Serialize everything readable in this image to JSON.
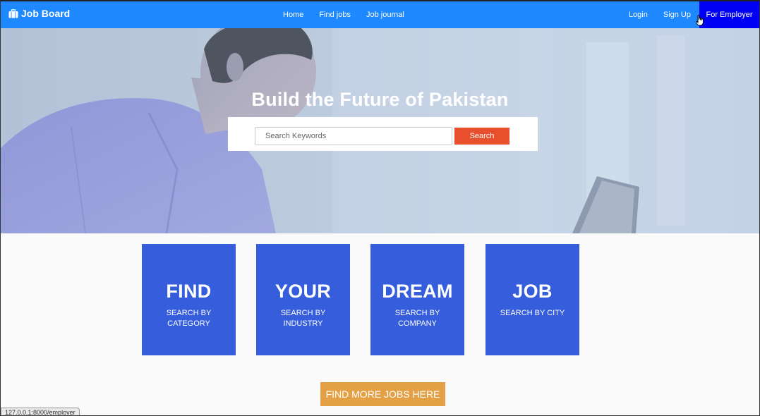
{
  "navbar": {
    "brand": "Job Board",
    "brand_icon": "briefcase-icon",
    "links": [
      "Home",
      "Find jobs",
      "Job journal"
    ],
    "login": "Login",
    "signup": "Sign Up",
    "employer": "For Employer",
    "bg_color": "#1e88ff",
    "employer_color": "#0000f5"
  },
  "hero": {
    "title": "Build the Future of Pakistan",
    "search_placeholder": "Search Keywords",
    "search_button": "Search",
    "search_button_color": "#e8502d"
  },
  "tiles": [
    {
      "big": "FIND",
      "sub": "SEARCH BY CATEGORY"
    },
    {
      "big": "YOUR",
      "sub": "SEARCH BY INDUSTRY"
    },
    {
      "big": "DREAM",
      "sub": "SEARCH BY COMPANY"
    },
    {
      "big": "JOB",
      "sub": "SEARCH BY CITY"
    }
  ],
  "tile_color": "#355ddc",
  "more_button": "FIND MORE JOBS HERE",
  "more_button_color": "#e3a045",
  "status_bar_url": "127.0.0.1:8000/employer"
}
